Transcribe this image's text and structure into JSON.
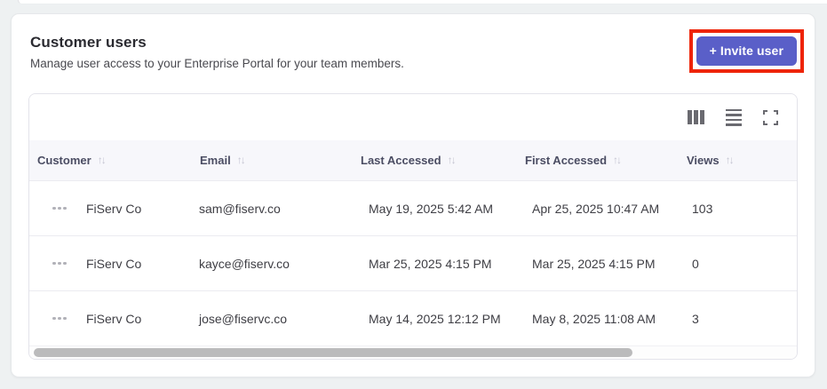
{
  "header": {
    "title": "Customer users",
    "subtitle": "Manage user access to your Enterprise Portal for your team members.",
    "invite_button_label": "+ Invite user",
    "invite_button_color": "#5a5fc8",
    "annotation_color": "#ee2408"
  },
  "toolbar": {
    "icons": [
      "columns-icon",
      "density-icon",
      "fullscreen-icon"
    ]
  },
  "table": {
    "sort_icon": "↑↓",
    "columns": [
      {
        "label": "Customer"
      },
      {
        "label": "Email"
      },
      {
        "label": "Last Accessed"
      },
      {
        "label": "First Accessed"
      },
      {
        "label": "Views"
      }
    ],
    "rows": [
      {
        "customer": "FiServ Co",
        "email": "sam@fiserv.co",
        "last_accessed": "May 19, 2025 5:42 AM",
        "first_accessed": "Apr 25, 2025 10:47 AM",
        "views": "103"
      },
      {
        "customer": "FiServ Co",
        "email": "kayce@fiserv.co",
        "last_accessed": "Mar 25, 2025 4:15 PM",
        "first_accessed": "Mar 25, 2025 4:15 PM",
        "views": "0"
      },
      {
        "customer": "FiServ Co",
        "email": "jose@fiservc.co",
        "last_accessed": "May 14, 2025 12:12 PM",
        "first_accessed": "May 8, 2025 11:08 AM",
        "views": "3"
      }
    ]
  },
  "scrollbar": {
    "thumb_percent": 78
  }
}
